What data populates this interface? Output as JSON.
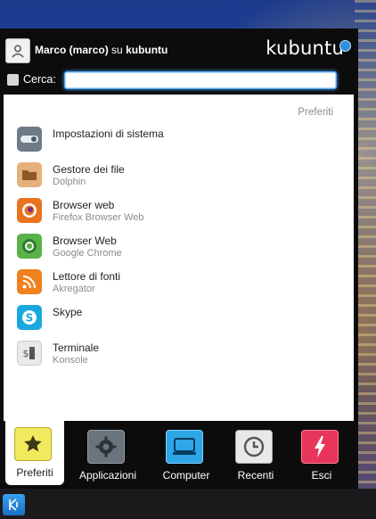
{
  "header": {
    "user_name": "Marco (marco)",
    "user_sep": "su",
    "host": "kubuntu",
    "logo": "kubuntu"
  },
  "search": {
    "label": "Cerca:",
    "value": "",
    "placeholder": ""
  },
  "favorites": {
    "section_title": "Preferiti",
    "items": [
      {
        "title": "Impostazioni di sistema",
        "subtitle": "",
        "icon": "system-settings-icon"
      },
      {
        "title": "Gestore dei file",
        "subtitle": "Dolphin",
        "icon": "folder-icon"
      },
      {
        "title": "Browser web",
        "subtitle": "Firefox Browser Web",
        "icon": "firefox-icon"
      },
      {
        "title": "Browser Web",
        "subtitle": "Google Chrome",
        "icon": "chrome-icon"
      },
      {
        "title": "Lettore di fonti",
        "subtitle": "Akregator",
        "icon": "rss-icon"
      },
      {
        "title": "Skype",
        "subtitle": "",
        "icon": "skype-icon"
      },
      {
        "title": "Terminale",
        "subtitle": "Konsole",
        "icon": "terminal-icon"
      }
    ]
  },
  "tabs": [
    {
      "label": "Preferiti",
      "icon": "star-icon",
      "active": true
    },
    {
      "label": "Applicazioni",
      "icon": "gear-icon",
      "active": false
    },
    {
      "label": "Computer",
      "icon": "computer-icon",
      "active": false
    },
    {
      "label": "Recenti",
      "icon": "clock-icon",
      "active": false
    },
    {
      "label": "Esci",
      "icon": "power-icon",
      "active": false
    }
  ],
  "colors": {
    "accent": "#4aa3ff",
    "panel": "#0c0c0d",
    "tab_favorites": "#f1e95e",
    "tab_apps": "#6b747c",
    "tab_computer": "#2fa6e6",
    "tab_recent": "#e8e8e8",
    "tab_logout": "#e8355b"
  }
}
